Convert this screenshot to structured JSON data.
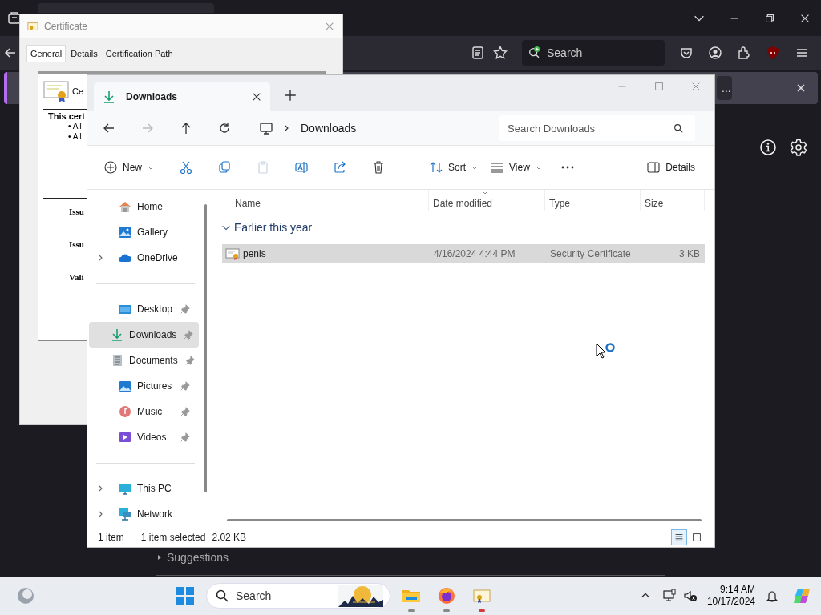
{
  "browser": {
    "search": {
      "placeholder": "Search"
    },
    "notification": {
      "button": "..."
    },
    "suggestions": "Suggestions"
  },
  "certificate_window": {
    "title": "Certificate",
    "tabs": [
      {
        "label": "General",
        "selected": true
      },
      {
        "label": "Details",
        "selected": false
      },
      {
        "label": "Certification Path",
        "selected": false
      }
    ],
    "heading": "Ce",
    "intro": "This cert",
    "bullets": [
      "• All",
      "• All"
    ],
    "fields": [
      "Issu",
      "Issu",
      "Vali"
    ]
  },
  "explorer": {
    "tabs": [
      {
        "label": "Downloads",
        "selected": true
      }
    ],
    "breadcrumb": [
      "Downloads"
    ],
    "search": {
      "placeholder": "Search Downloads"
    },
    "toolbar": {
      "new": "New",
      "paste_disabled": true,
      "sort": "Sort",
      "view": "View",
      "details": "Details"
    },
    "sidebar": [
      [
        {
          "label": "Home",
          "expandable": false,
          "pinned": false,
          "selected": false
        },
        {
          "label": "Gallery",
          "expandable": false,
          "pinned": false,
          "selected": false
        },
        {
          "label": "OneDrive",
          "expandable": true,
          "pinned": false,
          "selected": false
        }
      ],
      [
        {
          "label": "Desktop",
          "expandable": false,
          "pinned": true,
          "selected": false
        },
        {
          "label": "Downloads",
          "expandable": false,
          "pinned": true,
          "selected": true
        },
        {
          "label": "Documents",
          "expandable": false,
          "pinned": true,
          "selected": false
        },
        {
          "label": "Pictures",
          "expandable": false,
          "pinned": true,
          "selected": false
        },
        {
          "label": "Music",
          "expandable": false,
          "pinned": true,
          "selected": false
        },
        {
          "label": "Videos",
          "expandable": false,
          "pinned": true,
          "selected": false
        }
      ],
      [
        {
          "label": "This PC",
          "expandable": true,
          "pinned": false,
          "selected": false
        },
        {
          "label": "Network",
          "expandable": true,
          "pinned": false,
          "selected": false
        }
      ]
    ],
    "columns": [
      {
        "label": "Name",
        "sorted": false
      },
      {
        "label": "Date modified",
        "sorted": true
      },
      {
        "label": "Type",
        "sorted": false
      },
      {
        "label": "Size",
        "sorted": false
      }
    ],
    "groups": [
      {
        "label": "Earlier this year",
        "expanded": true,
        "rows": [
          {
            "name": "penis",
            "date": "4/16/2024 4:44 PM",
            "type": "Security Certificate",
            "size": "3 KB",
            "selected": true
          }
        ]
      }
    ],
    "status": {
      "count": "1 item",
      "selection": "1 item selected",
      "size": "2.02 KB"
    },
    "view_modes": [
      {
        "selected": true
      },
      {
        "selected": false
      }
    ]
  },
  "taskbar": {
    "search": {
      "placeholder": "Search"
    },
    "apps": [
      {
        "active": false
      },
      {
        "active": false
      },
      {
        "active": true
      }
    ],
    "time": "9:14 AM",
    "date": "10/17/2024"
  }
}
